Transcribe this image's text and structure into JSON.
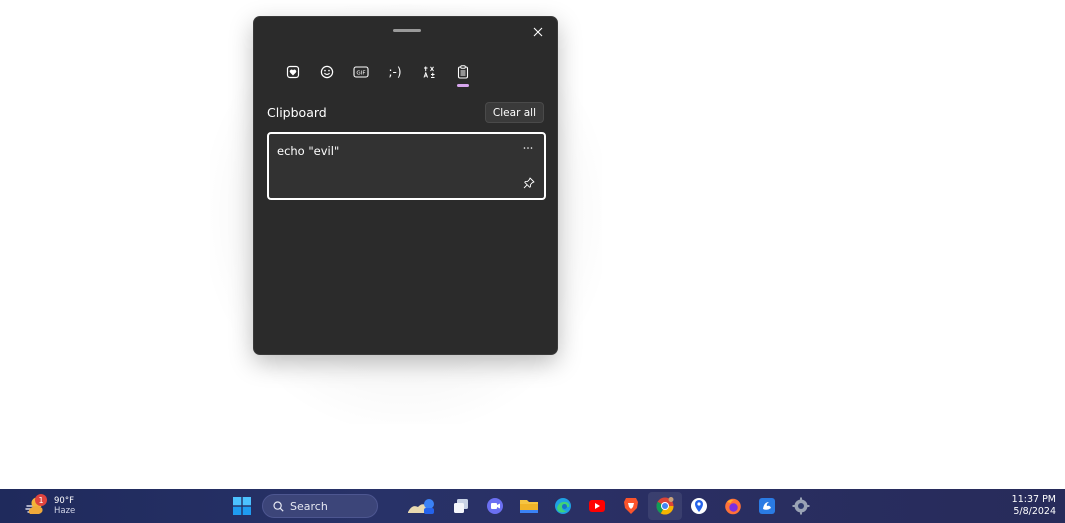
{
  "emoji_panel": {
    "tabs": [
      {
        "id": "stickers",
        "icon": "heart-sticker-icon"
      },
      {
        "id": "emoji",
        "icon": "smiley-icon"
      },
      {
        "id": "gif",
        "icon": "gif-icon",
        "label": "GIF"
      },
      {
        "id": "kaomoji",
        "icon": "kaomoji-icon",
        "label": ";-)"
      },
      {
        "id": "symbols",
        "icon": "symbols-icon"
      },
      {
        "id": "clipboard",
        "icon": "clipboard-icon",
        "active": true
      }
    ],
    "section_title": "Clipboard",
    "clear_all_label": "Clear all",
    "items": [
      {
        "text": "echo \"evil\"",
        "more_label": "···"
      }
    ]
  },
  "taskbar": {
    "weather": {
      "temp": "90°F",
      "condition": "Haze",
      "badge": "1"
    },
    "search_label": "Search",
    "apps": [
      {
        "name": "widgets-app",
        "icon": "widgets-icon"
      },
      {
        "name": "task-view",
        "icon": "task-view-icon"
      },
      {
        "name": "teams-chat",
        "icon": "chat-icon"
      },
      {
        "name": "file-explorer",
        "icon": "folder-icon"
      },
      {
        "name": "edge",
        "icon": "edge-icon"
      },
      {
        "name": "youtube",
        "icon": "youtube-icon"
      },
      {
        "name": "brave",
        "icon": "brave-icon"
      },
      {
        "name": "chrome",
        "icon": "chrome-icon",
        "active": true
      },
      {
        "name": "maps",
        "icon": "maps-icon"
      },
      {
        "name": "firefox",
        "icon": "firefox-icon"
      },
      {
        "name": "photos-app",
        "icon": "app-icon"
      },
      {
        "name": "settings",
        "icon": "gear-icon"
      }
    ],
    "clock": {
      "time": "11:37 PM",
      "date": "5/8/2024"
    }
  },
  "colors": {
    "panel_bg": "#2b2b2b",
    "accent_indicator": "#d7a6ee",
    "taskbar_bg": "#283268"
  }
}
